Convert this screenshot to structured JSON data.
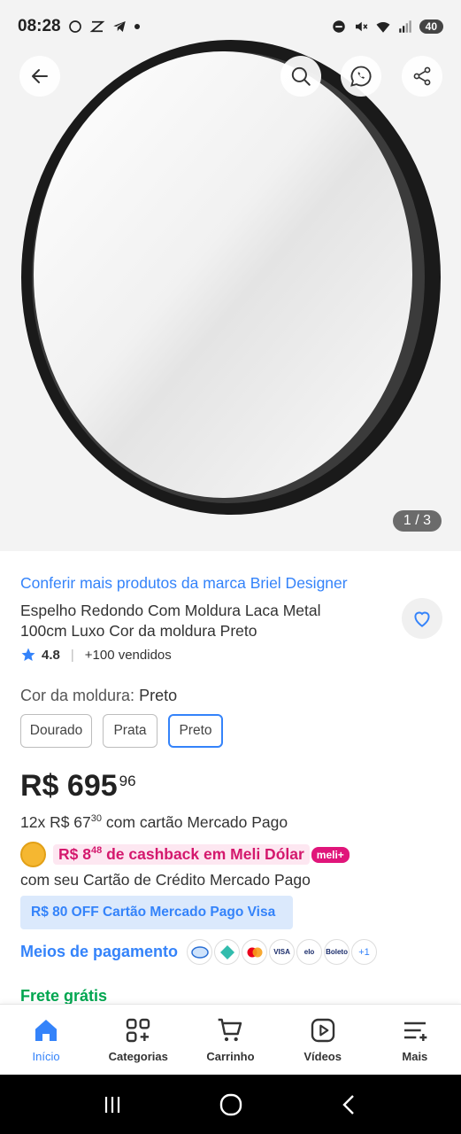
{
  "status_bar": {
    "time": "08:28",
    "battery": "40"
  },
  "gallery": {
    "counter": "1 / 3"
  },
  "product": {
    "brand_link": "Conferir mais produtos da marca Briel Designer",
    "title": "Espelho Redondo Com Moldura Laca Metal 100cm Luxo Cor da moldura Preto",
    "rating": "4.8",
    "sold": "+100 vendidos",
    "color_label": "Cor da moldura: ",
    "color_value": "Preto",
    "color_options": [
      "Dourado",
      "Prata",
      "Preto"
    ],
    "selected_color": "Preto",
    "price_main": "R$ 695",
    "price_cents": "96",
    "installments_prefix": "12x R$ 67",
    "installments_cents": "30",
    "installments_suffix": " com cartão Mercado Pago",
    "cashback_prefix": "R$ 8",
    "cashback_cents": "48",
    "cashback_suffix": " de cashback em Meli Dólar",
    "meli_badge": "meli+",
    "card_note": "com seu Cartão de Crédito Mercado Pago",
    "promo": "R$ 80 OFF Cartão Mercado Pago Visa",
    "payment_link": "Meios de pagamento",
    "payment_more": "+1",
    "payment_icons": [
      "visa-text",
      "elo-text",
      "boleto-text"
    ],
    "payment_labels": {
      "visa": "VISA",
      "elo": "elo",
      "boleto": "Boleto"
    },
    "shipping": "Frete grátis"
  },
  "bottom_nav": [
    {
      "label": "Início",
      "active": true
    },
    {
      "label": "Categorias"
    },
    {
      "label": "Carrinho"
    },
    {
      "label": "Vídeos"
    },
    {
      "label": "Mais"
    }
  ],
  "colors": {
    "accent": "#3483fa",
    "cashback": "#d4186d",
    "shipping": "#00a650"
  }
}
